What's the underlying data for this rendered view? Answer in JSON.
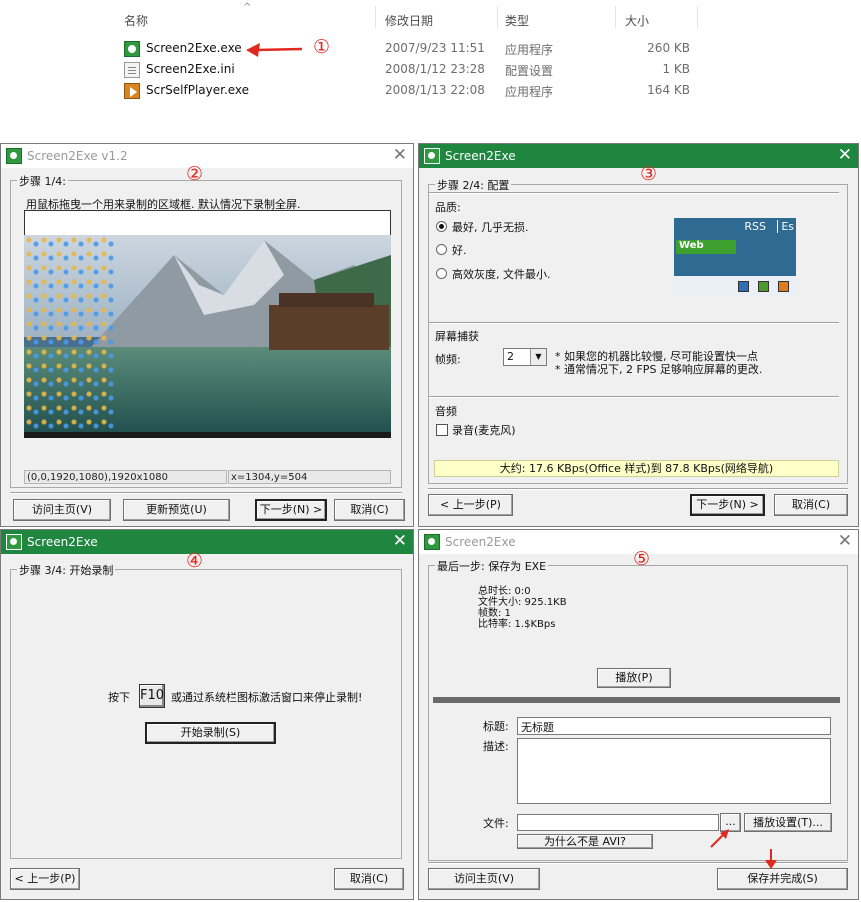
{
  "explorer": {
    "headers": {
      "name": "名称",
      "modified": "修改日期",
      "type": "类型",
      "size": "大小"
    },
    "files": [
      {
        "name": "Screen2Exe.exe",
        "date": "2007/9/23 11:51",
        "type": "应用程序",
        "size": "260 KB",
        "icon": "exe-icon"
      },
      {
        "name": "Screen2Exe.ini",
        "date": "2008/1/12 23:28",
        "type": "配置设置",
        "size": "1 KB",
        "icon": "ini-file-icon"
      },
      {
        "name": "ScrSelfPlayer.exe",
        "date": "2008/1/13 22:08",
        "type": "应用程序",
        "size": "164 KB",
        "icon": "player-icon"
      }
    ]
  },
  "annotations": {
    "a1": "①",
    "a2": "②",
    "a3": "③",
    "a4": "④",
    "a5": "⑤"
  },
  "step1": {
    "title": "Screen2Exe v1.2",
    "group": "步骤 1/4:",
    "instruction": "用鼠标拖曳一个用来录制的区域框. 默认情况下录制全屏.",
    "region": "(0,0,1920,1080),1920x1080",
    "coords": "x=1304,y=504",
    "buttons": {
      "home": "访问主页(V)",
      "refresh": "更新预览(U)",
      "next": "下一步(N) >",
      "cancel": "取消(C)"
    }
  },
  "step2": {
    "title": "Screen2Exe",
    "group": "步骤 2/4: 配置",
    "quality_label": "品质:",
    "quality_options": [
      "最好, 几乎无损.",
      "好.",
      "高效灰度, 文件最小."
    ],
    "selected_quality": 0,
    "preview": {
      "rss": "RSS",
      "es": "Es",
      "web": "Web"
    },
    "capture_label": "屏幕捕获",
    "fps_label": "帧频:",
    "fps_value": "2",
    "fps_note1": "* 如果您的机器比较慢, 尽可能设置快一点",
    "fps_note2": "* 通常情况下, 2 FPS 足够响应屏幕的更改.",
    "audio_label": "音频",
    "mic_label": "录音(麦克风)",
    "bandwidth": "大约: 17.6 KBps(Office 样式)到 87.8 KBps(网络导航)",
    "buttons": {
      "back": "< 上一步(P)",
      "next": "下一步(N) >",
      "cancel": "取消(C)"
    },
    "colors": {
      "blue": "#2f6fb5",
      "green": "#4c9a2a",
      "orange": "#e07b1f"
    }
  },
  "step3": {
    "title": "Screen2Exe",
    "group": "步骤 3/4: 开始录制",
    "press": "按下",
    "key": "F10",
    "hint": "或通过系统栏图标激活窗口来停止录制!",
    "start": "开始录制(S)",
    "buttons": {
      "back": "< 上一步(P)",
      "cancel": "取消(C)"
    }
  },
  "step4": {
    "title": "Screen2Exe",
    "group": "最后一步: 保存为 EXE",
    "stats": [
      "总时长: 0:0",
      "文件大小: 925.1KB",
      "帧数: 1",
      "比特率: 1.$KBps"
    ],
    "play": "播放(P)",
    "title_label": "标题:",
    "title_value": "无标题",
    "desc_label": "描述:",
    "file_label": "文件:",
    "browse": "...",
    "play_settings": "播放设置(T)...",
    "why_not_avi": "为什么不是 AVI?",
    "buttons": {
      "home": "访问主页(V)",
      "save": "保存并完成(S)"
    }
  }
}
